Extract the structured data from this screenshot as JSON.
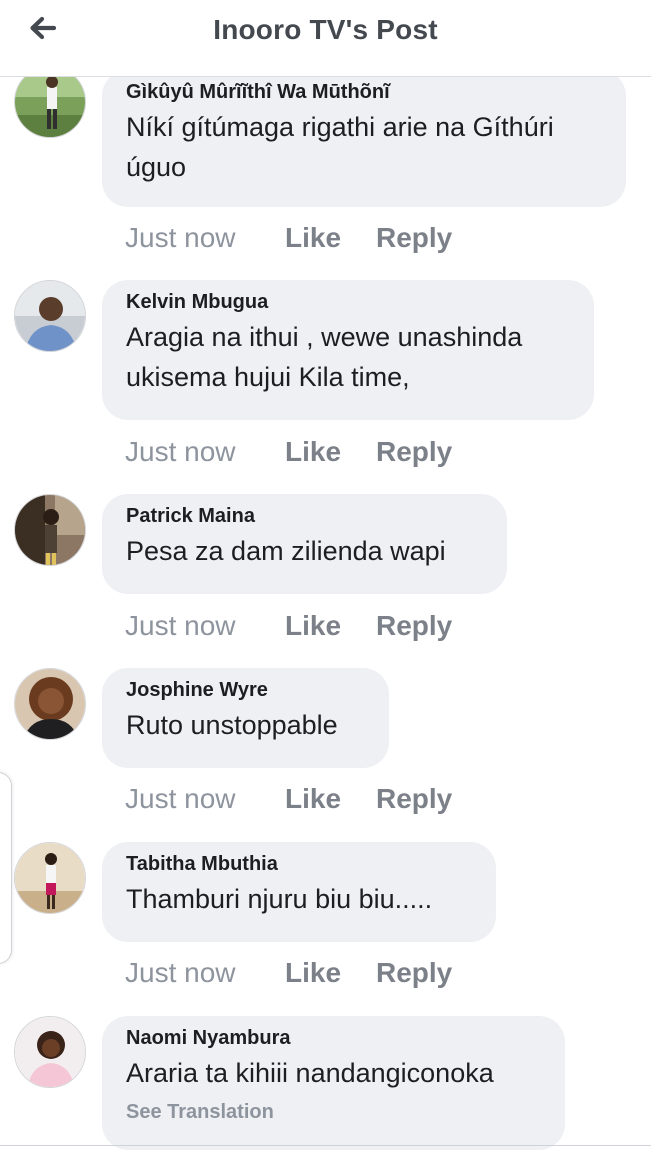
{
  "header": {
    "title": "Inooro TV's Post",
    "back_icon": "arrow-left-icon"
  },
  "colors": {
    "bubble": "#eef0f4",
    "author": "#1c1e21",
    "muted": "#8d949e",
    "action": "#7b8089"
  },
  "comments": [
    {
      "author": "Gìkûyû Mûrĩĩthî Wa Mūthõnĩ",
      "text": "Níkí gítúmaga rigathi arie na Gíthúri úguo",
      "time": "Just now",
      "like": "Like",
      "reply": "Reply"
    },
    {
      "author": "Kelvin Mbugua",
      "text": "Aragia na ithui , wewe unashinda ukisema hujui Kila time,",
      "time": "Just now",
      "like": "Like",
      "reply": "Reply"
    },
    {
      "author": "Patrick Maina",
      "text": "Pesa za dam zilienda wapi",
      "time": "Just now",
      "like": "Like",
      "reply": "Reply"
    },
    {
      "author": "Josphine Wyre",
      "text": "Ruto unstoppable",
      "time": "Just now",
      "like": "Like",
      "reply": "Reply"
    },
    {
      "author": "Tabitha Mbuthia",
      "text": "Thamburi njuru biu biu.....",
      "time": "Just now",
      "like": "Like",
      "reply": "Reply"
    },
    {
      "author": "Naomi Nyambura",
      "text": "Araria ta kihiii nandangiconoka",
      "see_translation": "See Translation"
    }
  ]
}
